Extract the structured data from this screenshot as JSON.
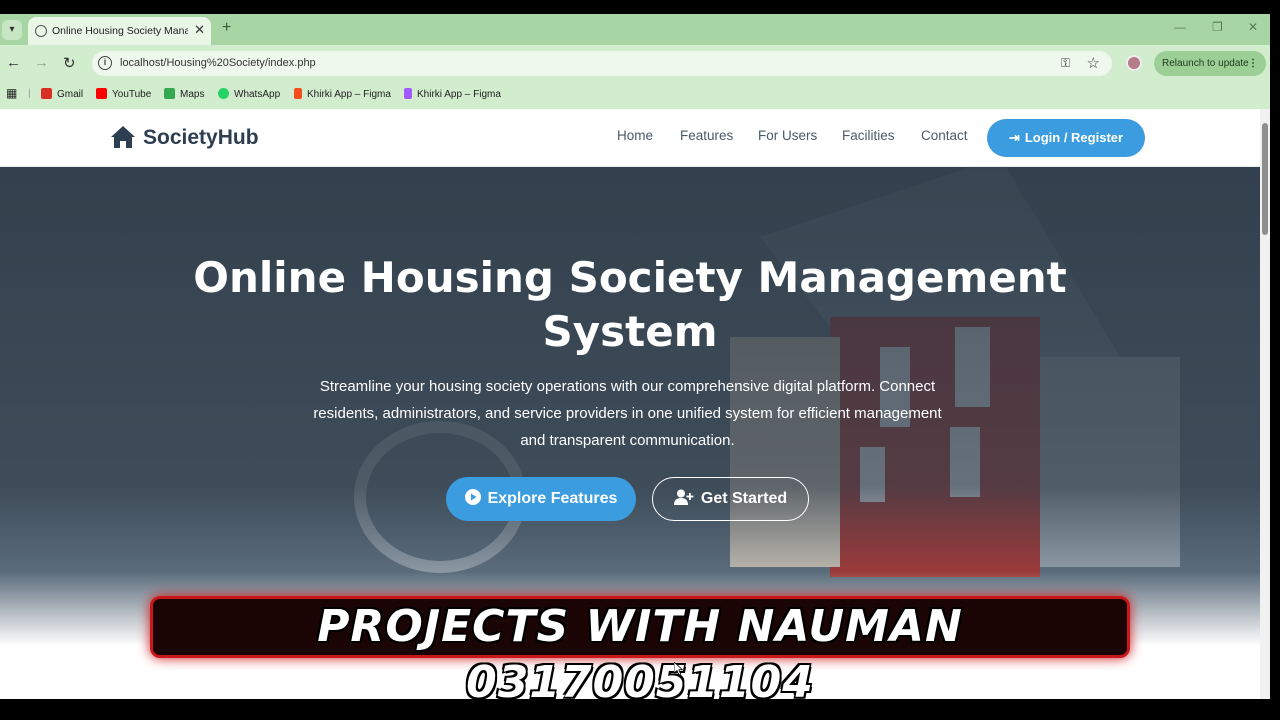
{
  "browser": {
    "tab_title": "Online Housing Society Manag",
    "url": "localhost/Housing%20Society/index.php",
    "relaunch_label": "Relaunch to update",
    "bookmarks": [
      {
        "label": "Gmail",
        "icon": "gmail-icon",
        "color": "#d93025"
      },
      {
        "label": "YouTube",
        "icon": "youtube-icon",
        "color": "#ff0000"
      },
      {
        "label": "Maps",
        "icon": "maps-icon",
        "color": "#34a853"
      },
      {
        "label": "WhatsApp",
        "icon": "whatsapp-icon",
        "color": "#25d366"
      },
      {
        "label": "Khirki App – Figma",
        "icon": "figma-icon",
        "color": "#f24e1e"
      },
      {
        "label": "Khirki App – Figma",
        "icon": "figma-icon",
        "color": "#a259ff"
      }
    ]
  },
  "site": {
    "brand": "SocietyHub",
    "nav": [
      "Home",
      "Features",
      "For Users",
      "Facilities",
      "Contact"
    ],
    "login_label": "Login / Register",
    "accent": "#3b9ce0",
    "brand_color": "#2c3e50"
  },
  "hero": {
    "title": "Online Housing Society Management System",
    "subtitle": "Streamline your housing society operations with our comprehensive digital platform. Connect residents, administrators, and service providers in one unified system for efficient management and transparent communication.",
    "explore_label": "Explore Features",
    "start_label": "Get Started"
  },
  "overlay_banner": {
    "text": "PROJECTS WITH NAUMAN 03170051104",
    "border_color": "#c61818"
  }
}
